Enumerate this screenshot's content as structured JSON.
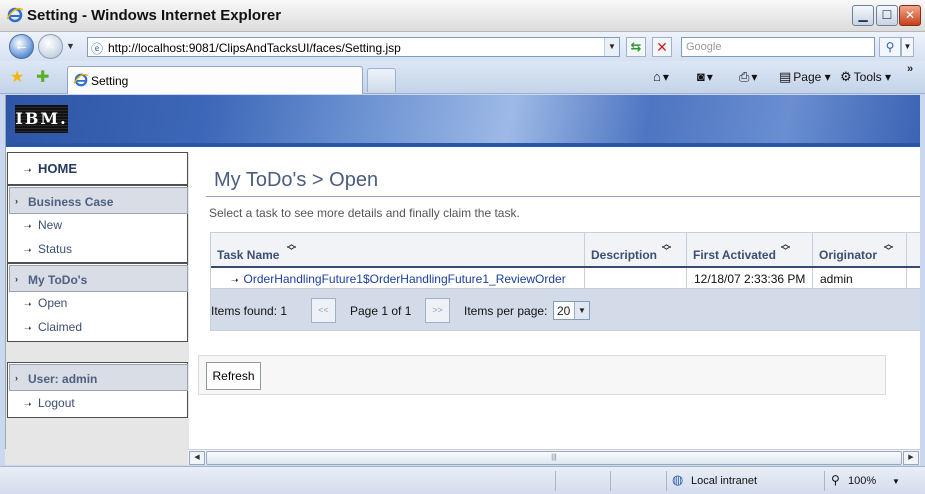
{
  "window": {
    "title": "Setting - Windows Internet Explorer"
  },
  "toolbar": {
    "back_icon": "arrow-left-icon",
    "forward_icon": "arrow-right-icon",
    "url": "http://localhost:9081/ClipsAndTacksUI/faces/Setting.jsp",
    "search_placeholder": "Google",
    "page_label": "Page",
    "tools_label": "Tools",
    "overflow": "»"
  },
  "tab": {
    "label": "Setting"
  },
  "branding": {
    "logo": "IBM."
  },
  "sidebar": {
    "home": "HOME",
    "business_case": {
      "header": "Business Case",
      "items": [
        "New",
        "Status"
      ]
    },
    "todos": {
      "header": "My ToDo's",
      "items": [
        "Open",
        "Claimed"
      ]
    },
    "user": {
      "header": "User: admin",
      "items": [
        "Logout"
      ]
    }
  },
  "main": {
    "heading": "My ToDo's > Open",
    "subtitle": "Select a task to see more details and finally claim the task.",
    "table": {
      "columns": [
        "Task Name",
        "Description",
        "First Activated",
        "Originator"
      ],
      "rows": [
        {
          "task": "OrderHandlingFuture1$OrderHandlingFuture1_ReviewOrder",
          "description": "",
          "first_activated": "12/18/07 2:33:36 PM",
          "originator": "admin"
        }
      ]
    },
    "pager": {
      "items_found": "Items found: 1",
      "prev": "<<",
      "page": "Page 1 of 1",
      "next": ">>",
      "per_page_label": "Items per page:",
      "per_page_value": "20"
    },
    "refresh_label": "Refresh"
  },
  "statusbar": {
    "zone": "Local intranet",
    "zoom": "100%"
  },
  "colors": {
    "banner": "#3d67b8",
    "link": "#1b3fa0",
    "heading": "#4a5d7d"
  }
}
